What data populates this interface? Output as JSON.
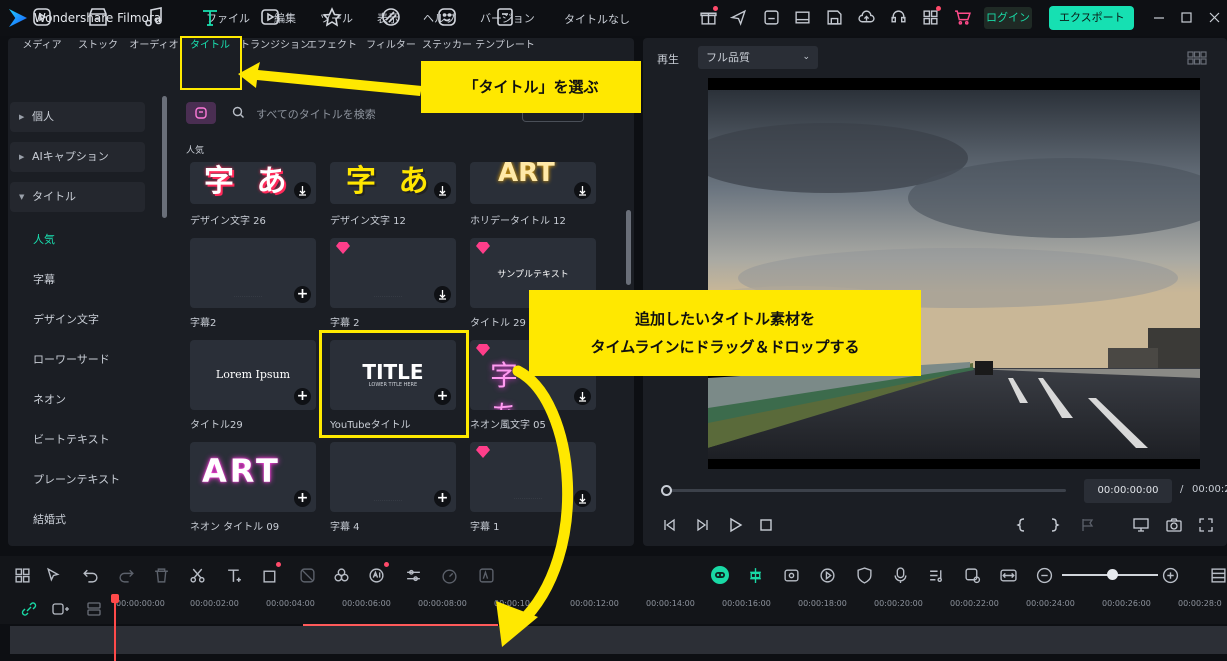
{
  "app": {
    "name": "Wondershare Filmora",
    "project_title": "タイトルなし",
    "login_label": "ログイン",
    "export_label": "エクスポート"
  },
  "menu": [
    "ファイル",
    "編集",
    "ツール",
    "表示",
    "ヘルプ",
    "バージョン"
  ],
  "tabs": [
    "メディア",
    "ストック",
    "オーディオ",
    "タイトル",
    "トランジション",
    "エフェクト",
    "フィルター",
    "ステッカー",
    "テンプレート"
  ],
  "active_tab": "タイトル",
  "sidebar": {
    "groups": [
      "個人",
      "AIキャプション",
      "タイトル"
    ],
    "items": [
      "人気",
      "字幕",
      "デザイン文字",
      "ローワーサード",
      "ネオン",
      "ビートテキスト",
      "プレーンテキスト",
      "結婚式"
    ],
    "active_item": "人気"
  },
  "search": {
    "placeholder": "すべてのタイトルを検索"
  },
  "section_label": "人気",
  "cards": [
    {
      "label": "デザイン文字 26",
      "thumb": "字 あ"
    },
    {
      "label": "デザイン文字 12",
      "thumb": "字 あ"
    },
    {
      "label": "ホリデータイトル 12",
      "thumb": "ART"
    },
    {
      "label": "字幕2",
      "thumb": ""
    },
    {
      "label": "字幕 2",
      "thumb": ""
    },
    {
      "label": "タイトル 29",
      "thumb": "サンプルテキスト"
    },
    {
      "label": "タイトル29",
      "thumb": "Lorem Ipsum"
    },
    {
      "label": "YouTubeタイトル",
      "thumb": "TITLE",
      "thumb_sub": "LOWER TITLE HERE"
    },
    {
      "label": "ネオン風文字 05",
      "thumb": "字 あ"
    },
    {
      "label": "ネオン タイトル 09",
      "thumb": "ART"
    },
    {
      "label": "字幕 4",
      "thumb": ""
    },
    {
      "label": "字幕 1",
      "thumb": ""
    }
  ],
  "callouts": {
    "tab": "「タイトル」を選ぶ",
    "drag_line1": "追加したいタイトル素材を",
    "drag_line2": "タイムラインにドラッグ＆ドロップする"
  },
  "preview": {
    "label": "再生",
    "quality": "フル品質",
    "timecode": "00:00:00:00",
    "separator": "/",
    "total": "00:00:2"
  },
  "ruler": [
    "00:00:00:00",
    "00:00:02:00",
    "00:00:04:00",
    "00:00:06:00",
    "00:00:08:00",
    "00:00:10",
    "00:00:12:00",
    "00:00:14:00",
    "00:00:16:00",
    "00:00:18:00",
    "00:00:20:00",
    "00:00:22:00",
    "00:00:24:00",
    "00:00:26:00",
    "00:00:28:0"
  ],
  "colors": {
    "accent": "#16e0b2",
    "highlight": "#ffea00",
    "playhead": "#ff4a4a",
    "panel": "#1b1e24",
    "gem": "#ff3e8a"
  }
}
